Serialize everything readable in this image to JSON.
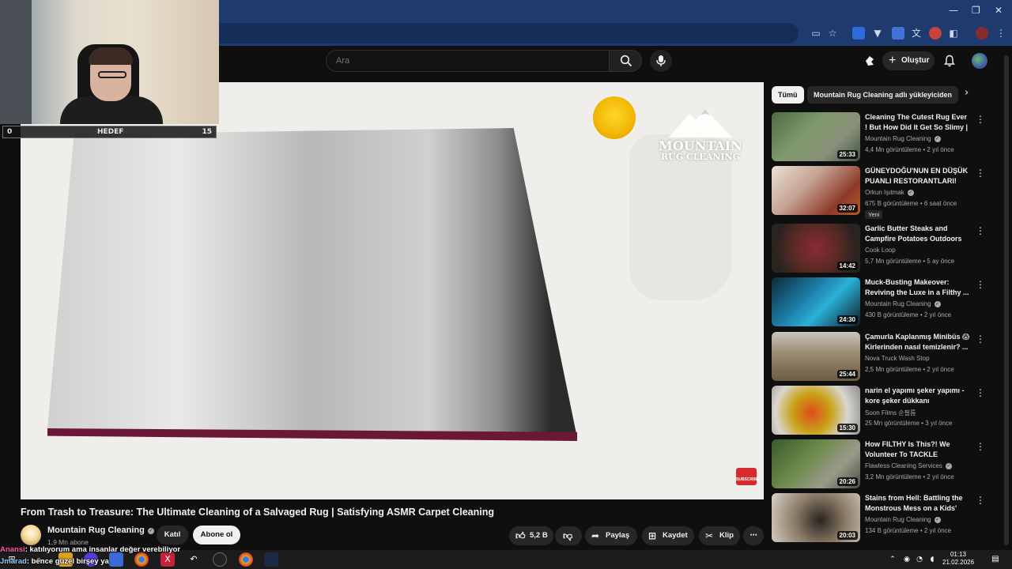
{
  "colors": {
    "browser_frame": "#1e3a6e",
    "yt_bg": "#0f0f0f",
    "accent_red": "#d42b2b"
  },
  "window_controls": {
    "minimize": "—",
    "restore": "❐",
    "close": "✕"
  },
  "search": {
    "placeholder": "Ara"
  },
  "header": {
    "create_label": "Oluştur"
  },
  "webcam_overlay": {
    "goal_left": "0",
    "goal_label": "HEDEF",
    "goal_right": "15"
  },
  "player": {
    "watermark_line1": "MOUNTAIN",
    "watermark_line2": "RUG CLEANING",
    "subscribe_mark": "SUBSCRIBE"
  },
  "video": {
    "title": "From Trash to Treasure: The Ultimate Cleaning of a Salvaged Rug | Satisfying ASMR Carpet Cleaning",
    "channel_name": "Mountain Rug Cleaning",
    "subscribers": "1,9 Mn abone",
    "join_label": "Katıl",
    "subscribe_label": "Abone ol",
    "likes": "5,2 B",
    "share_label": "Paylaş",
    "save_label": "Kaydet",
    "clip_label": "Klip"
  },
  "chat": [
    {
      "user": "Anansi",
      "text": ": katılıyorum ama insanlar değer verebiliyor"
    },
    {
      "user": "Jmarad",
      "text": ": bence güzel birşey ya"
    }
  ],
  "sidebar": {
    "chips": [
      "Tümü",
      "Mountain Rug Cleaning adlı yükleyiciden"
    ],
    "recommendations": [
      {
        "title": "Cleaning The Cutest Rug Ever ! But How Did It Get So Slimy | ...",
        "channel": "Mountain Rug Cleaning",
        "verified": true,
        "views": "4,4 Mn görüntüleme",
        "age": "2 yıl önce",
        "duration": "25:33",
        "badge": ""
      },
      {
        "title": "GÜNEYDOĞU'NUN EN DÜŞÜK PUANLI RESTORANTLARI!",
        "channel": "Orkun Işıtmak",
        "verified": true,
        "views": "675 B görüntüleme",
        "age": "6 saat önce",
        "duration": "32:07",
        "badge": "Yeni"
      },
      {
        "title": "Garlic Butter Steaks and Campfire Potatoes Outdoors",
        "channel": "Cook Loop",
        "verified": false,
        "views": "5,7 Mn görüntüleme",
        "age": "5 ay önce",
        "duration": "14:42",
        "badge": ""
      },
      {
        "title": "Muck-Busting Makeover: Reviving the Luxe in a Filthy ...",
        "channel": "Mountain Rug Cleaning",
        "verified": true,
        "views": "430 B görüntüleme",
        "age": "2 yıl önce",
        "duration": "24:30",
        "badge": ""
      },
      {
        "title": "Çamurla Kaplanmış Minibüs 😱 Kirlerinden nasıl temizlenir? ...",
        "channel": "Nova Truck Wash Stop",
        "verified": false,
        "views": "2,5 Mn görüntüleme",
        "age": "2 yıl önce",
        "duration": "25:44",
        "badge": ""
      },
      {
        "title": "narin el yapımı şeker yapımı - kore şeker dükkanı",
        "channel": "Soon Films 순필름",
        "verified": false,
        "views": "25 Mn görüntüleme",
        "age": "3 yıl önce",
        "duration": "15:30",
        "badge": ""
      },
      {
        "title": "How FILTHY Is This?! We Volunteer To TACKLE Decades...",
        "channel": "Flawless Cleaning Services",
        "verified": true,
        "views": "3,2 Mn görüntüleme",
        "age": "2 yıl önce",
        "duration": "20:26",
        "badge": ""
      },
      {
        "title": "Stains from Hell: Battling the Monstrous Mess on a Kids' Rug",
        "channel": "Mountain Rug Cleaning",
        "verified": true,
        "views": "134 B görüntüleme",
        "age": "2 yıl önce",
        "duration": "20:03",
        "badge": ""
      }
    ]
  },
  "taskbar": {
    "time": "01:13",
    "date": "21.02.2026"
  }
}
